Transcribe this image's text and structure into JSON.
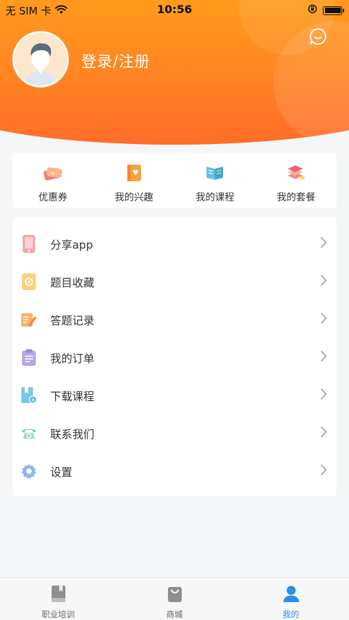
{
  "status_bar": {
    "carrier": "无 SIM 卡",
    "time": "10:56"
  },
  "profile": {
    "login_label": "登录/注册"
  },
  "quick_actions": [
    {
      "label": "优惠券",
      "icon": "coupon-icon"
    },
    {
      "label": "我的兴趣",
      "icon": "interest-icon"
    },
    {
      "label": "我的课程",
      "icon": "course-book-icon"
    },
    {
      "label": "我的套餐",
      "icon": "package-icon"
    }
  ],
  "menu": [
    {
      "label": "分享app",
      "icon": "phone-share-icon",
      "color": "#f6a3a3"
    },
    {
      "label": "题目收藏",
      "icon": "favorite-icon",
      "color": "#ffd27a"
    },
    {
      "label": "答题记录",
      "icon": "answer-record-icon",
      "color": "#f6b26b"
    },
    {
      "label": "我的订单",
      "icon": "order-clipboard-icon",
      "color": "#b7a6e6"
    },
    {
      "label": "下载课程",
      "icon": "download-course-icon",
      "color": "#7cc7e8"
    },
    {
      "label": "联系我们",
      "icon": "telephone-icon",
      "color": "#7ccfae"
    },
    {
      "label": "设置",
      "icon": "settings-gear-icon",
      "color": "#8ab6f2"
    }
  ],
  "tabbar": [
    {
      "label": "职业培训",
      "icon": "book-icon",
      "active": false
    },
    {
      "label": "商城",
      "icon": "shopping-bag-icon",
      "active": false
    },
    {
      "label": "我的",
      "icon": "user-icon",
      "active": true
    }
  ],
  "colors": {
    "header_top": "#ffc21a",
    "header_bottom": "#ff6d2a",
    "accent_blue": "#2b8de6"
  }
}
